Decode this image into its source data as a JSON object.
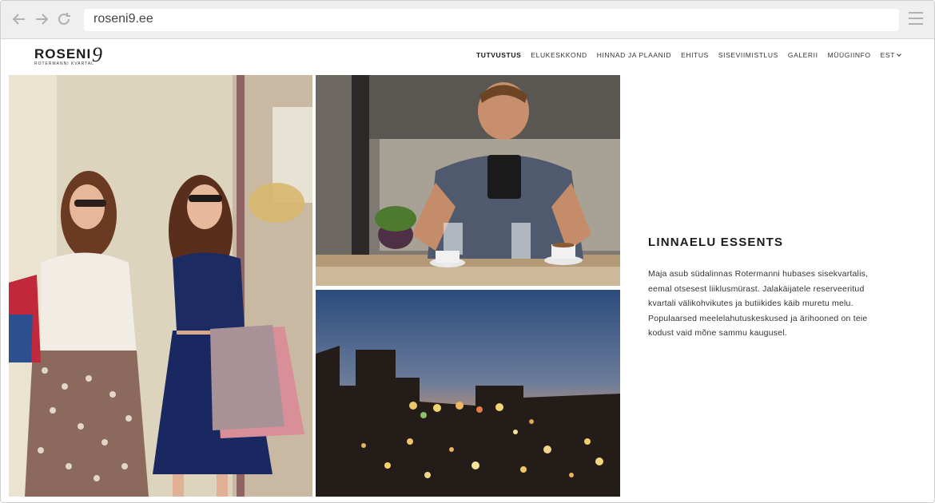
{
  "browser": {
    "url": "roseni9.ee",
    "icons": [
      "back-arrow-icon",
      "forward-arrow-icon",
      "reload-icon",
      "hamburger-menu-icon"
    ]
  },
  "site": {
    "logo_text": "ROSENI",
    "logo_number": "9",
    "logo_sub": "ROTERMANNI KVARTAL",
    "nav": [
      {
        "label": "TUTVUSTUS",
        "active": true
      },
      {
        "label": "ELUKESKKOND"
      },
      {
        "label": "HINNAD JA PLAANID"
      },
      {
        "label": "EHITUS"
      },
      {
        "label": "SISEVIIMISTLUS"
      },
      {
        "label": "GALERII"
      },
      {
        "label": "MÜÜGIINFO"
      },
      {
        "label": "EST"
      }
    ]
  },
  "main": {
    "heading": "LINNAELU ESSENTS",
    "body": "Maja asub südalinnas Rotermanni hubases sisekvartalis, eemal otsesest liiklusmürast. Jalakäijatele reserveeritud kvartali välikohvikutes ja butiikides käib muretu melu. Populaarsed meelelahutuskeskused ja ärihooned on teie kodust vaid mõne sammu kaugusel."
  }
}
